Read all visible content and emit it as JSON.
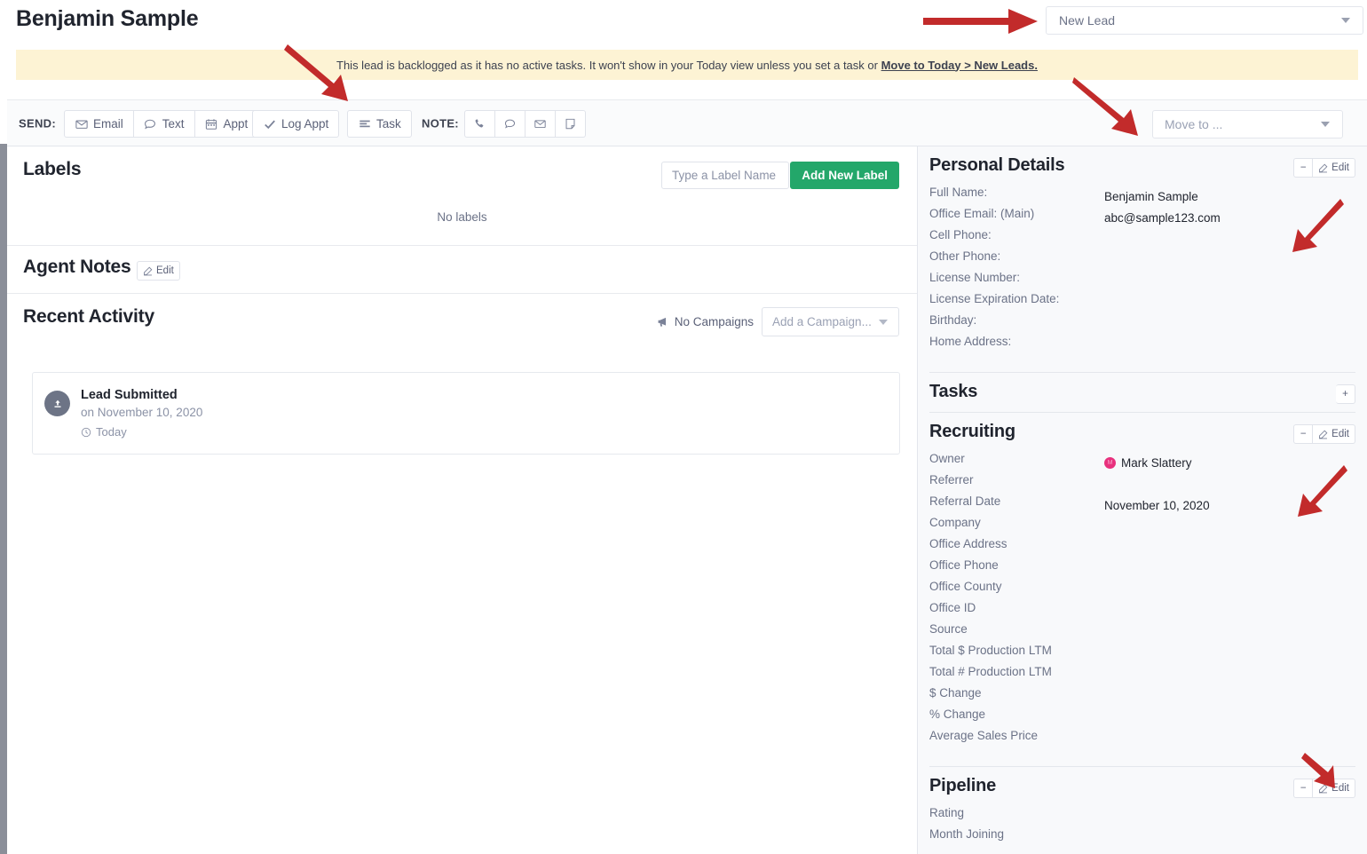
{
  "header": {
    "title": "Benjamin Sample",
    "status_select": {
      "value": "New Lead",
      "caret_icon": "chevron-down-icon"
    }
  },
  "banner": {
    "text_before": "This lead is backlogged as it has no active tasks. It won't show in your Today view unless you set a task or ",
    "link_text": "Move to Today > New Leads."
  },
  "actionbar": {
    "send_label": "SEND:",
    "note_label": "NOTE:",
    "send_buttons": [
      {
        "label": "Email",
        "icon": "envelope-icon"
      },
      {
        "label": "Text",
        "icon": "speech-bubble-icon"
      },
      {
        "label": "Appt",
        "icon": "calendar-icon"
      }
    ],
    "log_appt": {
      "label": "Log Appt",
      "icon": "check-icon"
    },
    "task": {
      "label": "Task",
      "icon": "task-list-icon"
    },
    "note_icons": [
      "phone-icon",
      "speech-bubble-icon",
      "envelope-icon",
      "note-icon"
    ],
    "move_to": {
      "placeholder": "Move to ...",
      "caret_icon": "chevron-down-icon"
    }
  },
  "labels_section": {
    "title": "Labels",
    "input_placeholder": "Type a Label Name",
    "input_value": "",
    "add_button": "Add New Label",
    "empty_text": "No labels"
  },
  "agent_notes": {
    "title": "Agent Notes",
    "edit_label": "Edit"
  },
  "recent_activity": {
    "title": "Recent Activity",
    "campaigns_status": "No Campaigns",
    "campaign_select_placeholder": "Add a Campaign...",
    "items": [
      {
        "icon": "upload-icon",
        "title": "Lead Submitted",
        "subtitle": "on November 10, 2020",
        "when": "Today",
        "when_icon": "clock-icon"
      }
    ]
  },
  "personal_details": {
    "title": "Personal Details",
    "collapse_label": "−",
    "edit_label": "Edit",
    "fields": [
      {
        "key": "Full Name:",
        "value": "Benjamin Sample"
      },
      {
        "key": "Office Email: (Main)",
        "value": "abc@sample123.com"
      },
      {
        "key": "Cell Phone:",
        "value": ""
      },
      {
        "key": "Other Phone:",
        "value": ""
      },
      {
        "key": "License Number:",
        "value": ""
      },
      {
        "key": "License Expiration Date:",
        "value": ""
      },
      {
        "key": "Birthday:",
        "value": ""
      },
      {
        "key": "Home Address:",
        "value": ""
      }
    ]
  },
  "tasks": {
    "title": "Tasks",
    "add_label": "+"
  },
  "recruiting": {
    "title": "Recruiting",
    "collapse_label": "−",
    "edit_label": "Edit",
    "owner_initial": "M",
    "fields": [
      {
        "key": "Owner",
        "value": "Mark Slattery",
        "avatar": true
      },
      {
        "key": "Referrer",
        "value": ""
      },
      {
        "key": "Referral Date",
        "value": "November 10, 2020"
      },
      {
        "key": "Company",
        "value": ""
      },
      {
        "key": "Office Address",
        "value": ""
      },
      {
        "key": "Office Phone",
        "value": ""
      },
      {
        "key": "Office County",
        "value": ""
      },
      {
        "key": "Office ID",
        "value": ""
      },
      {
        "key": "Source",
        "value": ""
      },
      {
        "key": "Total $ Production LTM",
        "value": ""
      },
      {
        "key": "Total # Production LTM",
        "value": ""
      },
      {
        "key": "$ Change",
        "value": ""
      },
      {
        "key": "% Change",
        "value": ""
      },
      {
        "key": "Average Sales Price",
        "value": ""
      }
    ]
  },
  "pipeline": {
    "title": "Pipeline",
    "collapse_label": "−",
    "edit_label": "Edit",
    "fields": [
      {
        "key": "Rating",
        "value": ""
      },
      {
        "key": "Month Joining",
        "value": ""
      }
    ]
  },
  "colors": {
    "accent_green": "#23a76a",
    "banner_bg": "#fdf3d4",
    "avatar_pink": "#e8317d",
    "arrow_red": "#c22b2b",
    "panel_bg": "#f8f9fb"
  }
}
